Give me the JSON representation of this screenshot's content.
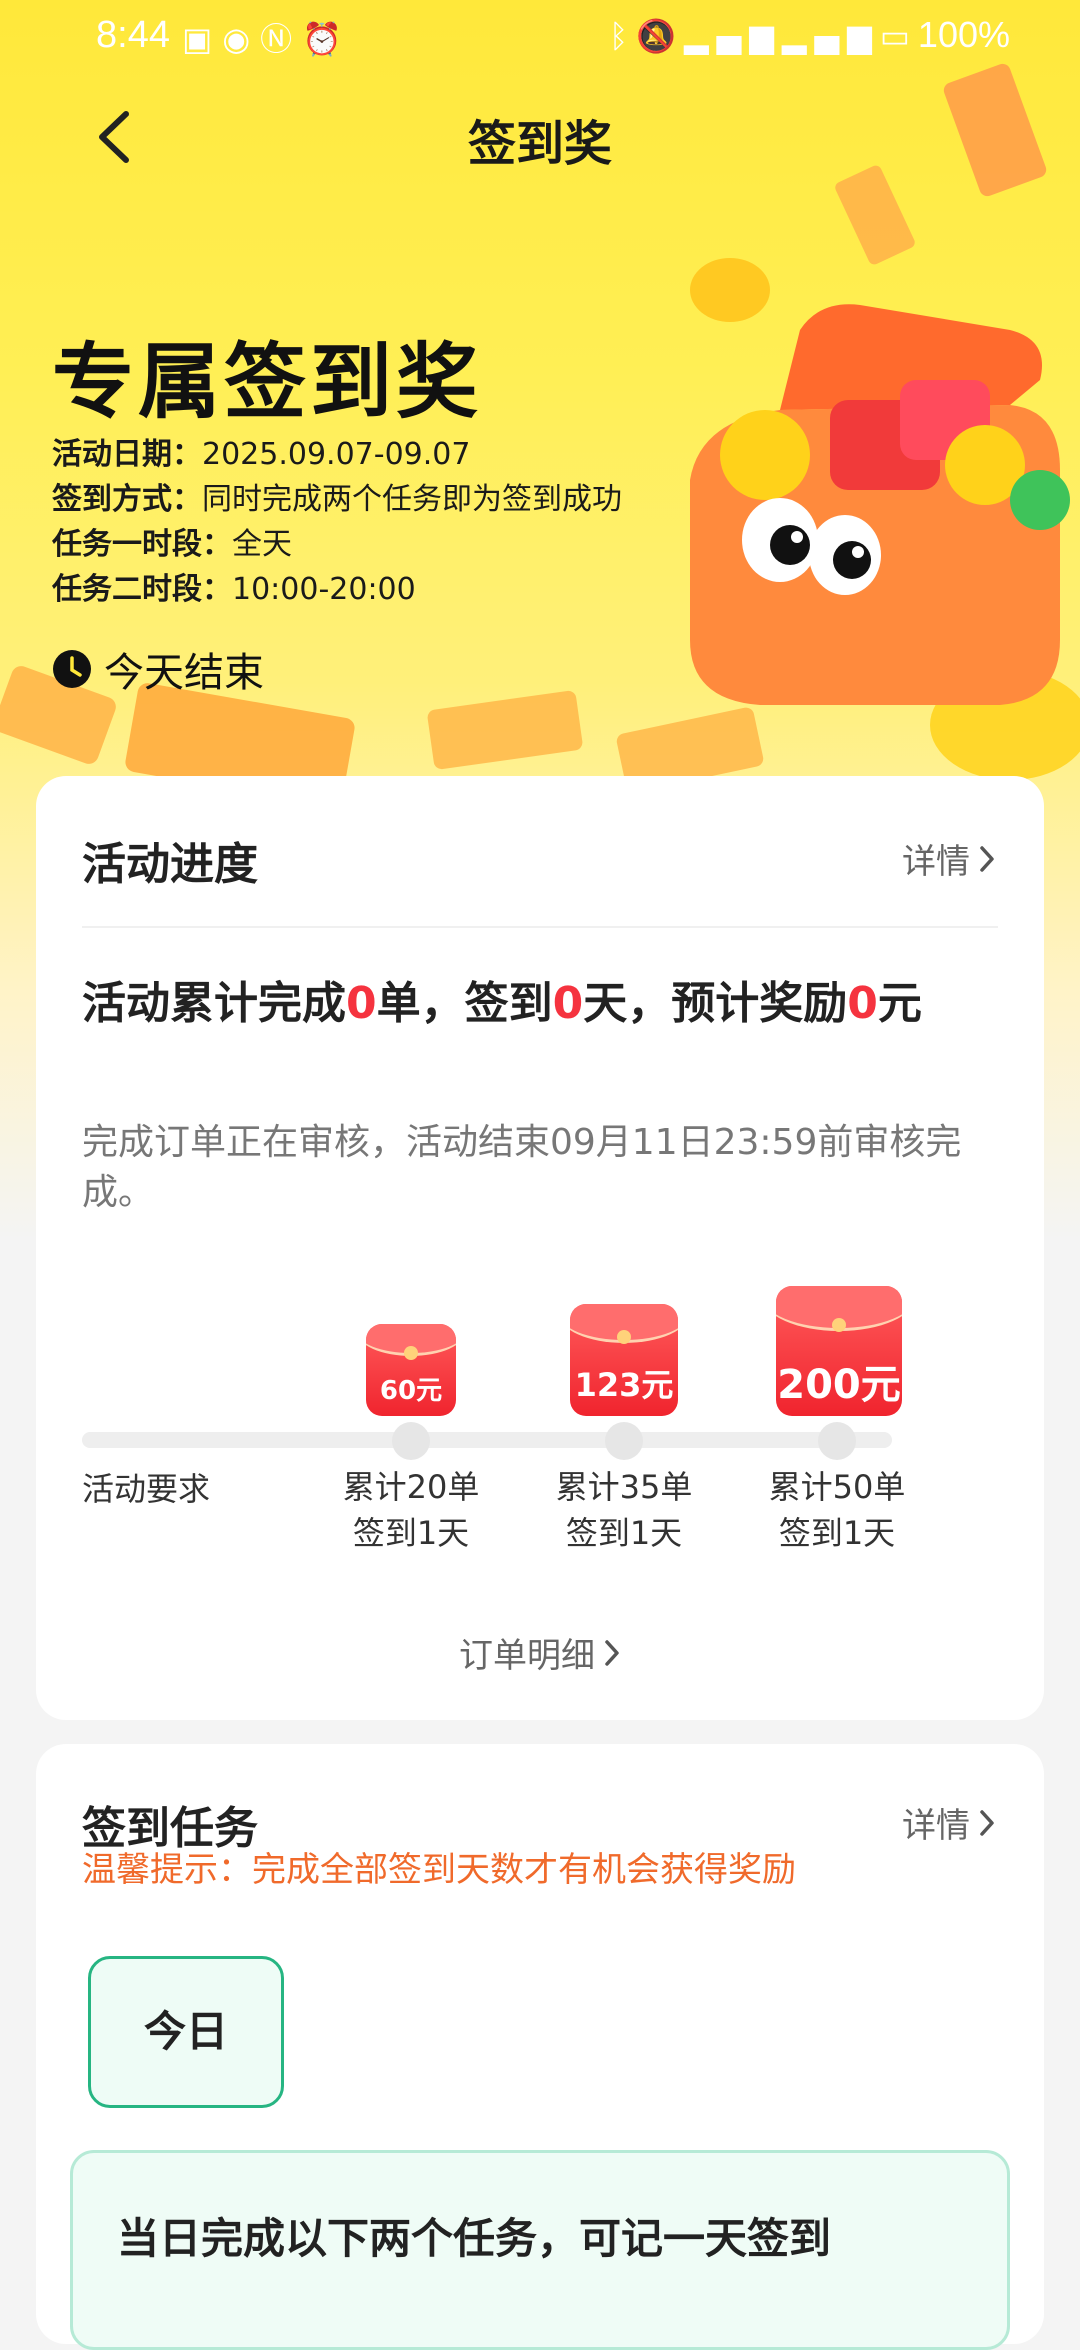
{
  "status_bar": {
    "time": "8:44",
    "left_icons": [
      "app-notification-icon",
      "eye-icon",
      "nfc-icon",
      "alarm-icon"
    ],
    "right_icons": [
      "bluetooth-icon",
      "mute-icon",
      "signal-4g-icon",
      "signal-4g-icon",
      "battery-icon"
    ],
    "battery": "100%"
  },
  "nav": {
    "title": "签到奖"
  },
  "hero": {
    "title": "专属签到奖",
    "info": [
      {
        "key": "活动日期：",
        "value": "2025.09.07-09.07"
      },
      {
        "key": "签到方式：",
        "value": "同时完成两个任务即为签到成功"
      },
      {
        "key": "任务一时段：",
        "value": "全天"
      },
      {
        "key": "任务二时段：",
        "value": "10:00-20:00"
      }
    ],
    "ends": "今天结束"
  },
  "progress": {
    "title": "活动进度",
    "detail": "详情",
    "summary": {
      "p1": "活动累计完成",
      "orders": "0",
      "p2": "单，签到",
      "days": "0",
      "p3": "天，预计奖励",
      "reward": "0",
      "p4": "元"
    },
    "note": "完成订单正在审核，活动结束09月11日23:59前审核完成。",
    "requirement_label": "活动要求",
    "milestones": [
      {
        "reward": "60元",
        "line1": "累计20单",
        "line2": "签到1天"
      },
      {
        "reward": "123元",
        "line1": "累计35单",
        "line2": "签到1天"
      },
      {
        "reward": "200元",
        "line1": "累计50单",
        "line2": "签到1天"
      }
    ],
    "order_detail": "订单明细"
  },
  "checkin": {
    "title": "签到任务",
    "detail": "详情",
    "tip": "温馨提示：完成全部签到天数才有机会获得奖励",
    "tab": "今日",
    "task_title": "当日完成以下两个任务，可记一天签到"
  },
  "colors": {
    "accent_red": "#f5333f",
    "tip_orange": "#f06a2b",
    "green": "#26b582",
    "hero_yellow": "#ffe83a"
  }
}
